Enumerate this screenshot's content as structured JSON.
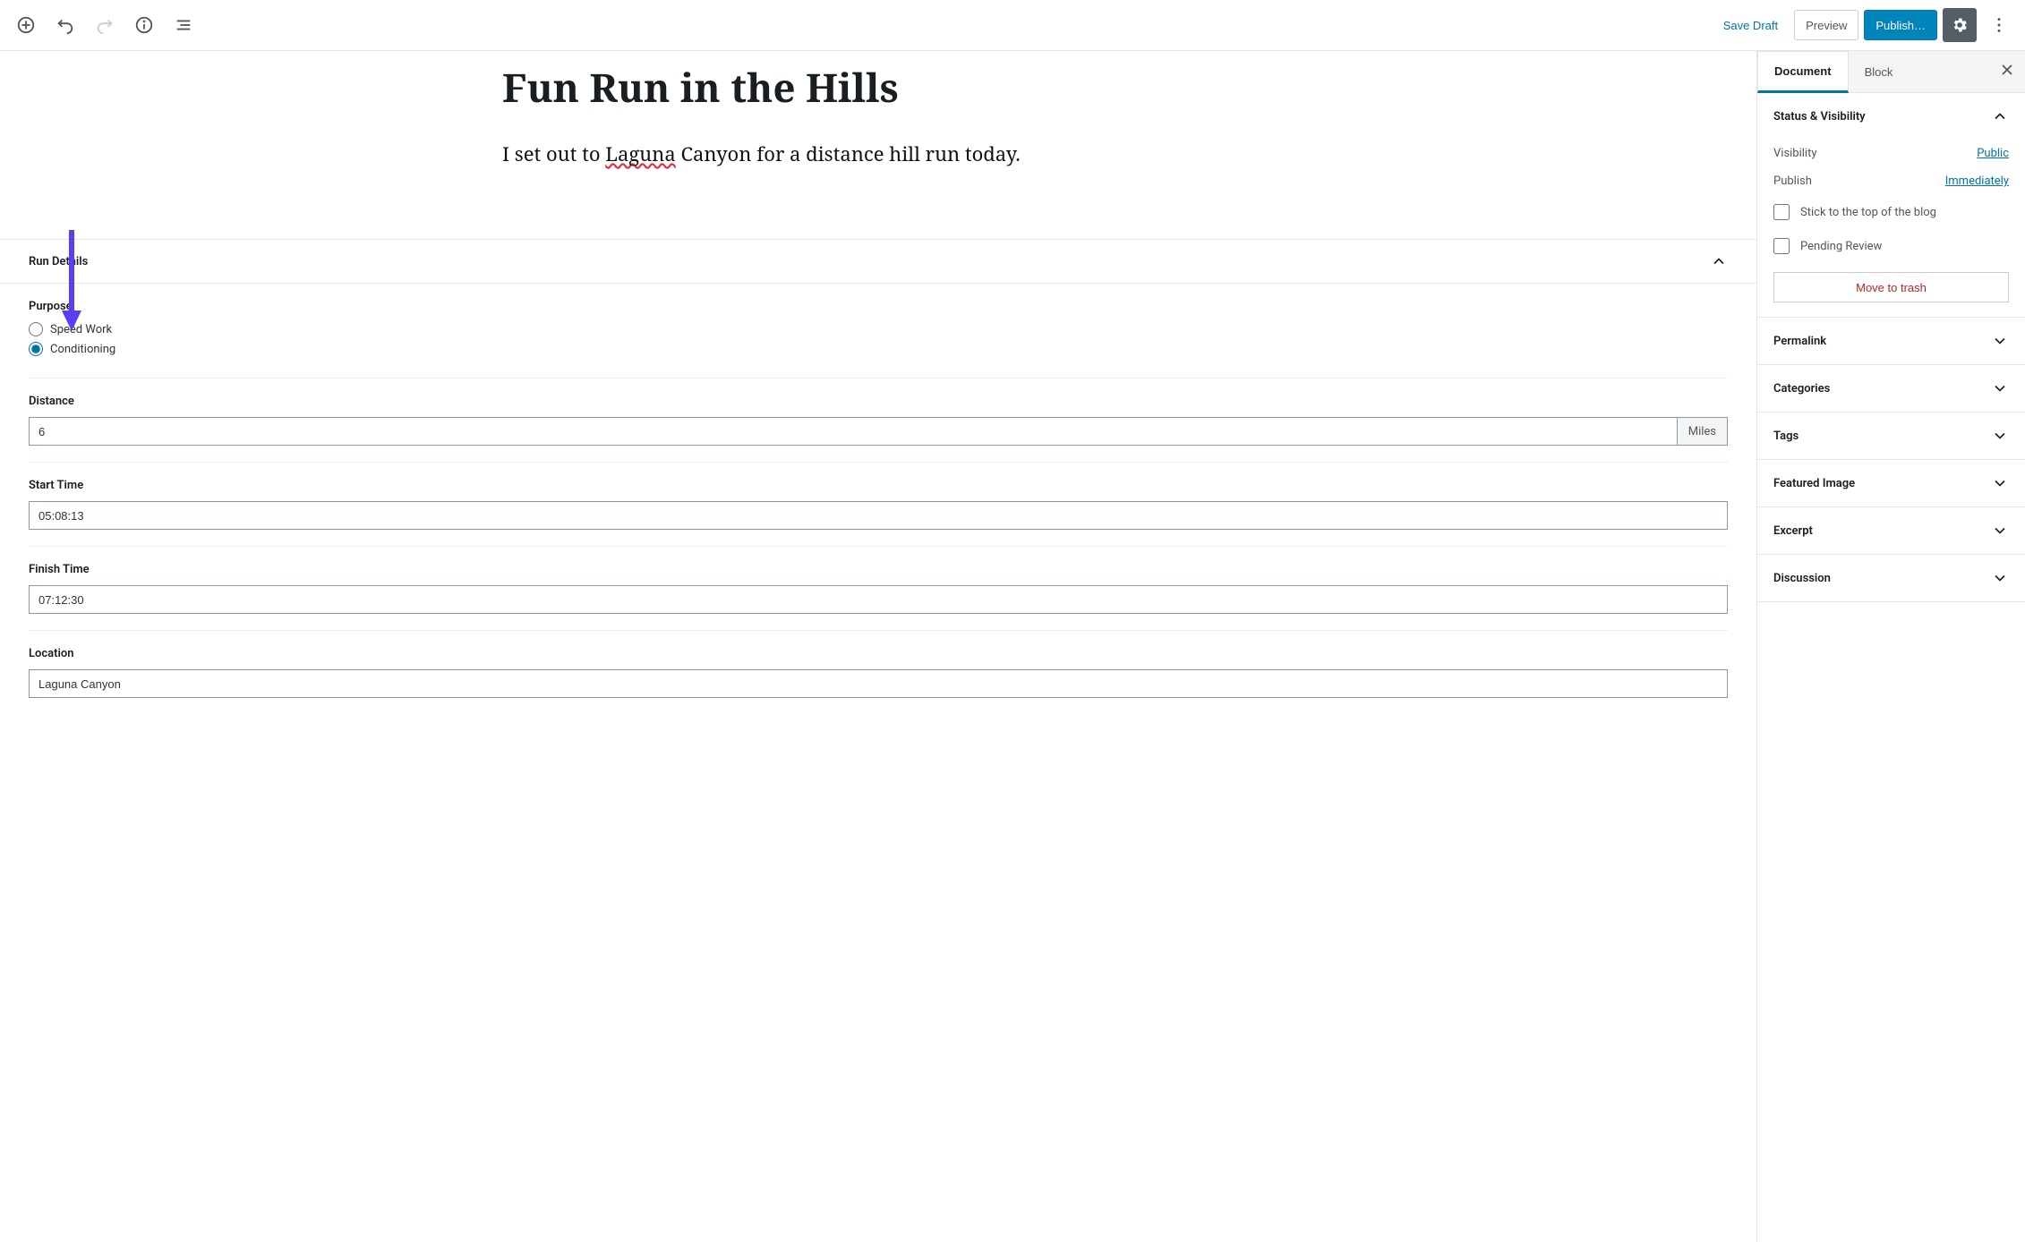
{
  "toolbar": {
    "save_draft": "Save Draft",
    "preview": "Preview",
    "publish": "Publish…"
  },
  "post": {
    "title": "Fun Run in the Hills",
    "body_before": "I set out to ",
    "body_misspelled": "Laguna",
    "body_after": " Canyon for a distance hill run today."
  },
  "meta": {
    "panel_title": "Run Details",
    "purpose": {
      "label": "Purpose",
      "options": [
        "Speed Work",
        "Conditioning"
      ],
      "selected": "Conditioning"
    },
    "distance": {
      "label": "Distance",
      "value": "6",
      "unit": "Miles"
    },
    "start_time": {
      "label": "Start Time",
      "value": "05:08:13"
    },
    "finish_time": {
      "label": "Finish Time",
      "value": "07:12:30"
    },
    "location": {
      "label": "Location",
      "value": "Laguna Canyon"
    }
  },
  "sidebar": {
    "tabs": {
      "document": "Document",
      "block": "Block"
    },
    "status_visibility": {
      "title": "Status & Visibility",
      "visibility_label": "Visibility",
      "visibility_value": "Public",
      "publish_label": "Publish",
      "publish_value": "Immediately",
      "stick_top": "Stick to the top of the blog",
      "pending_review": "Pending Review",
      "move_trash": "Move to trash"
    },
    "panels": [
      "Permalink",
      "Categories",
      "Tags",
      "Featured Image",
      "Excerpt",
      "Discussion"
    ]
  }
}
